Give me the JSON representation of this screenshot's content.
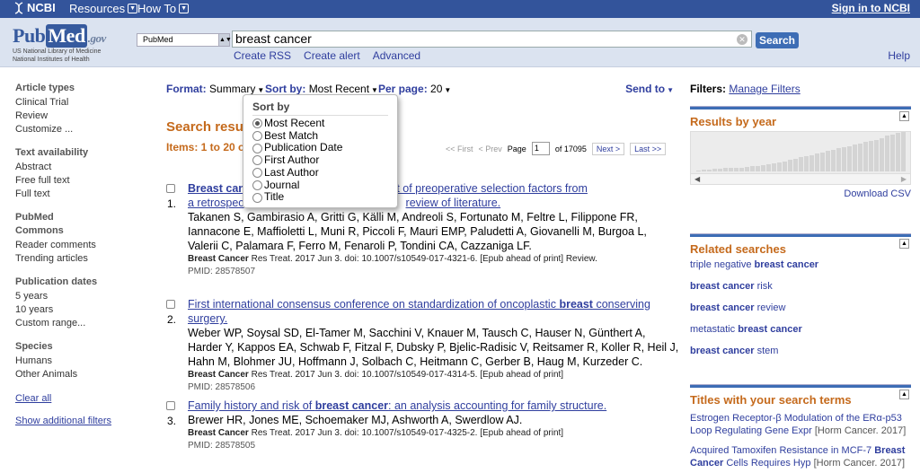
{
  "topbar": {
    "ncbi": "NCBI",
    "resources": "Resources",
    "howto": "How To",
    "signin": "Sign in to NCBI"
  },
  "header": {
    "logo_pub": "Pub",
    "logo_med": "Med",
    "logo_gov": ".gov",
    "logo_sub1": "US National Library of Medicine",
    "logo_sub2": "National Institutes of Health",
    "db": "PubMed",
    "query": "breast cancer",
    "search_btn": "Search",
    "links": [
      "Create RSS",
      "Create alert",
      "Advanced"
    ],
    "help": "Help"
  },
  "sidebar": {
    "groups": [
      {
        "head": "Article types",
        "items": [
          "Clinical Trial",
          "Review",
          "Customize ..."
        ]
      },
      {
        "head": "Text availability",
        "items": [
          "Abstract",
          "Free full text",
          "Full text"
        ]
      },
      {
        "head": "PubMed",
        "head2": "Commons",
        "items": [
          "Reader comments",
          "Trending articles"
        ]
      },
      {
        "head": "Publication dates",
        "items": [
          "5 years",
          "10 years",
          "Custom range..."
        ]
      },
      {
        "head": "Species",
        "items": [
          "Humans",
          "Other Animals"
        ]
      }
    ],
    "clear_all": "Clear all",
    "show_filters": "Show additional filters"
  },
  "formatbar": {
    "format_label": "Format:",
    "format_value": "Summary",
    "sort_label": "Sort by:",
    "sort_value": "Most Recent",
    "perpage_label": "Per page:",
    "perpage_value": "20",
    "send_to": "Send to"
  },
  "sort_dropdown": {
    "heading": "Sort by",
    "options": [
      "Most Recent",
      "Best Match",
      "Publication Date",
      "First Author",
      "Last Author",
      "Journal",
      "Title"
    ],
    "selected": 0
  },
  "results": {
    "title": "Search result",
    "items_text": "Items: 1 to 20 o",
    "pager": {
      "first": "<< First",
      "prev": "< Prev",
      "page_label": "Page",
      "page": "1",
      "of": "of 17095",
      "next": "Next >",
      "last": "Last >>"
    },
    "list": [
      {
        "num": "1.",
        "title_l1_bold": "Breast can",
        "title_l1": "herapy: assessment of preoperative selection factors from",
        "title_l2": "a retrospec",
        "title_l2b": "review of literature.",
        "authors": "Takanen S, Gambirasio A, Gritti G, Källi M, Andreoli S, Fortunato M, Feltre L, Filippone FR, Iannacone E, Maffioletti L, Muni R, Piccoli F, Mauri EMP, Paludetti A, Giovanelli M, Burgoa L, Valerii C, Palamara F, Ferro M, Fenaroli P, Tondini CA, Cazzaniga LF.",
        "source_bold": "Breast Cancer",
        "source": " Res Treat. 2017 Jun 3. doi: 10.1007/s10549-017-4321-6. [Epub ahead of print] Review.",
        "pmid": "PMID: 28578507"
      },
      {
        "num": "2.",
        "title_pre": "First international consensus conference on standardization of oncoplastic ",
        "title_bold": "breast",
        "title_post": " conserving surgery.",
        "authors": "Weber WP, Soysal SD, El-Tamer M, Sacchini V, Knauer M, Tausch C, Hauser N, Günthert A, Harder Y, Kappos EA, Schwab F, Fitzal F, Dubsky P, Bjelic-Radisic V, Reitsamer R, Koller R, Heil J, Hahn M, Blohmer JU, Hoffmann J, Solbach C, Heitmann C, Gerber B, Haug M, Kurzeder C.",
        "source_bold": "Breast Cancer",
        "source": " Res Treat. 2017 Jun 3. doi: 10.1007/s10549-017-4314-5. [Epub ahead of print]",
        "pmid": "PMID: 28578506"
      },
      {
        "num": "3.",
        "title_pre": "Family history and risk of ",
        "title_bold": "breast cancer",
        "title_post": ": an analysis accounting for family structure.",
        "authors": "Brewer HR, Jones ME, Schoemaker MJ, Ashworth A, Swerdlow AJ.",
        "source_bold": "Breast Cancer",
        "source": " Res Treat. 2017 Jun 3. doi: 10.1007/s10549-017-4325-2. [Epub ahead of print]",
        "pmid": "PMID: 28578505"
      }
    ]
  },
  "right": {
    "filters_label": "Filters:",
    "manage_filters": "Manage Filters",
    "results_by_year": "Results by year",
    "download_csv": "Download CSV",
    "related_searches": "Related searches",
    "related": [
      {
        "pre": "triple negative ",
        "bold": "breast cancer",
        "post": ""
      },
      {
        "pre": "",
        "bold": "breast cancer",
        "post": " risk"
      },
      {
        "pre": "",
        "bold": "breast cancer",
        "post": " review"
      },
      {
        "pre": "metastatic ",
        "bold": "breast cancer",
        "post": ""
      },
      {
        "pre": "",
        "bold": "breast cancer",
        "post": " stem"
      }
    ],
    "titles_head": "Titles with your search terms",
    "titles": [
      {
        "line1": "Estrogen Receptor-β Modulation of the ERα-p53",
        "line2": "Loop Regulating Gene Expr",
        "meta": "[Horm Cancer. 2017]"
      },
      {
        "line1_pre": "Acquired Tamoxifen Resistance in MCF-7 ",
        "line1_bold": "Breast",
        "line2_bold": "Cancer",
        "line2": " Cells Requires Hyp",
        "meta": "[Horm Cancer. 2017]"
      }
    ],
    "year_bars": [
      2,
      3,
      3,
      4,
      4,
      5,
      5,
      6,
      6,
      7,
      8,
      9,
      10,
      11,
      12,
      14,
      16,
      18,
      20,
      22,
      24,
      26,
      28,
      30,
      32,
      34,
      36,
      38,
      40,
      42,
      44,
      46,
      48,
      50,
      52,
      56,
      58,
      60,
      62
    ]
  }
}
